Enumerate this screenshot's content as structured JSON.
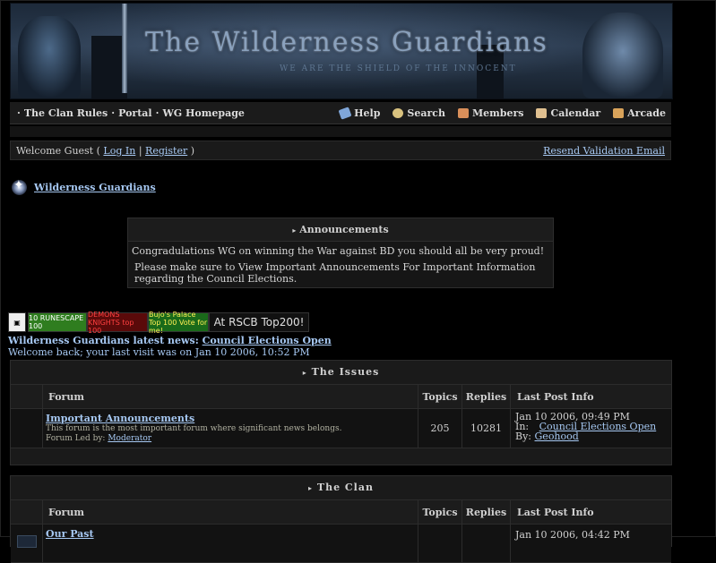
{
  "banner": {
    "title": "The Wilderness Guardians",
    "motto": "WE ARE THE SHIELD OF THE INNOCENT"
  },
  "nav": {
    "left": [
      "The Clan Rules",
      "Portal",
      "WG Homepage"
    ],
    "separator": "·",
    "right": [
      {
        "label": "Help",
        "icon": "help-icon",
        "color": "#7fa6d9"
      },
      {
        "label": "Search",
        "icon": "search-icon",
        "color": "#d9c27f"
      },
      {
        "label": "Members",
        "icon": "members-icon",
        "color": "#d98f5a"
      },
      {
        "label": "Calendar",
        "icon": "calendar-icon",
        "color": "#e0c090"
      },
      {
        "label": "Arcade",
        "icon": "arcade-icon",
        "color": "#d9a35a"
      }
    ]
  },
  "welcome": {
    "prefix": "Welcome Guest (",
    "login": "Log In",
    "pipe": "|",
    "register": "Register",
    "suffix": ")",
    "resend": "Resend Validation Email"
  },
  "breadcrumb": {
    "label": "Wilderness Guardians"
  },
  "announcements": {
    "title": "Announcements",
    "line1": "Congradulations WG on winning the War against BD you should all be very proud!",
    "line2": "Please make sure to View Important Announcements For Important Information regarding the Council Elections."
  },
  "buttons": [
    {
      "text": "10 RUNESCAPE 100",
      "bg": "#2f7d1f",
      "fg": "#ffffff"
    },
    {
      "text": "DEMONS KNIGHTS top 100",
      "bg": "#5a0a0a",
      "fg": "#ff4040"
    },
    {
      "text": "Bujo's Palace Top 100 Vote for me!",
      "bg": "#1a6a1a",
      "fg": "#ffee55"
    },
    {
      "text": "At RSCB Top200!",
      "bg": "#111111",
      "fg": "#e0e0e0"
    }
  ],
  "news": {
    "prefix": "Wilderness Guardians latest news:",
    "link": "Council Elections Open"
  },
  "last_visit": "Welcome back; your last visit was on Jan 10 2006, 10:52 PM",
  "columns": {
    "forum": "Forum",
    "topics": "Topics",
    "replies": "Replies",
    "last": "Last Post Info"
  },
  "categories": [
    {
      "title": "The Issues",
      "forums": [
        {
          "name": "Important Announcements",
          "desc": "This forum is the most important forum where significant news belongs.",
          "led_prefix": "Forum Led by:",
          "led_by": "Moderator",
          "topics": "205",
          "replies": "10281",
          "last_date": "Jan 10 2006, 09:49 PM",
          "in_label": "In:",
          "in_topic": "Council Elections Open",
          "by_label": "By:",
          "by_user": "Geohood"
        }
      ]
    },
    {
      "title": "The Clan",
      "forums": [
        {
          "name": "Our Past",
          "last_date": "Jan 10 2006, 04:42 PM"
        }
      ]
    }
  ]
}
